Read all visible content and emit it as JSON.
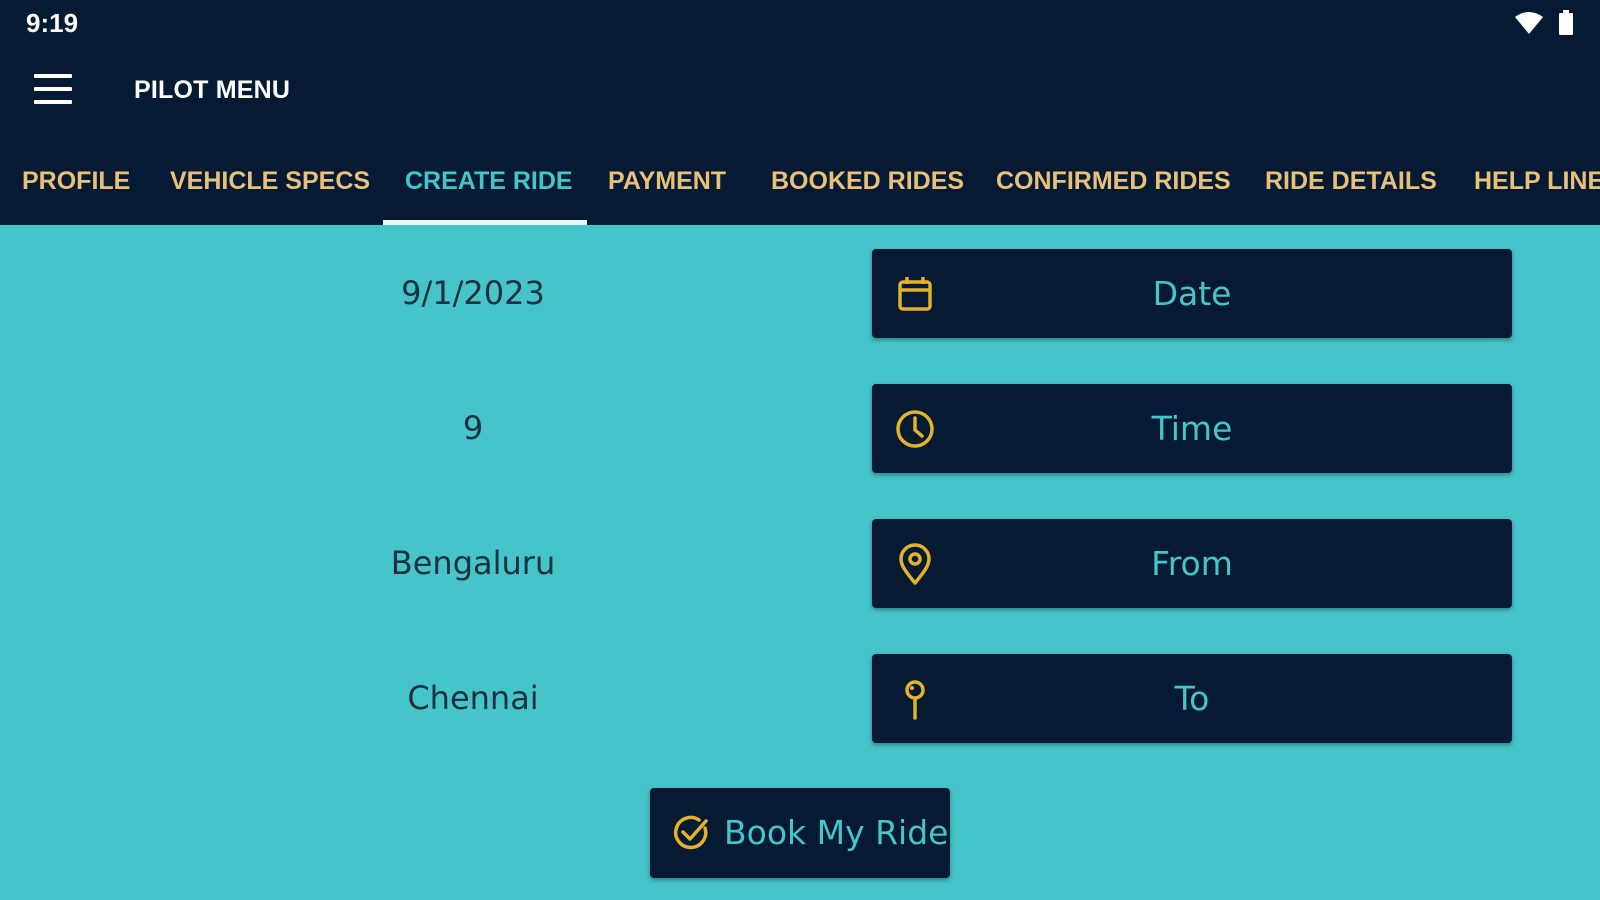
{
  "status_bar": {
    "time": "9:19",
    "icons": [
      "wifi-icon",
      "battery-icon"
    ]
  },
  "app_bar": {
    "title": "PILOT MENU",
    "menu_icon": "menu-icon"
  },
  "tabs": [
    {
      "label": "PROFILE",
      "active": false
    },
    {
      "label": "VEHICLE SPECS",
      "active": false
    },
    {
      "label": "CREATE RIDE",
      "active": true
    },
    {
      "label": "PAYMENT",
      "active": false
    },
    {
      "label": "BOOKED RIDES",
      "active": false
    },
    {
      "label": "CONFIRMED RIDES",
      "active": false
    },
    {
      "label": "RIDE DETAILS",
      "active": false
    },
    {
      "label": "HELP LINE",
      "active": false
    }
  ],
  "form": {
    "date": {
      "value": "9/1/2023",
      "button_label": "Date",
      "icon": "calendar-icon"
    },
    "time": {
      "value": "9",
      "button_label": "Time",
      "icon": "clock-icon"
    },
    "from": {
      "value": "Bengaluru",
      "button_label": "From",
      "icon": "location-pin-icon"
    },
    "to": {
      "value": "Chennai",
      "button_label": "To",
      "icon": "map-pin-icon"
    }
  },
  "book_button": {
    "label": "Book My Ride",
    "icon": "check-circle-icon"
  },
  "colors": {
    "background": "#45c4ca",
    "bar": "#071a33",
    "tab_text": "#e8c07a",
    "accent": "#45c4ca",
    "icon": "#e3b12a"
  }
}
